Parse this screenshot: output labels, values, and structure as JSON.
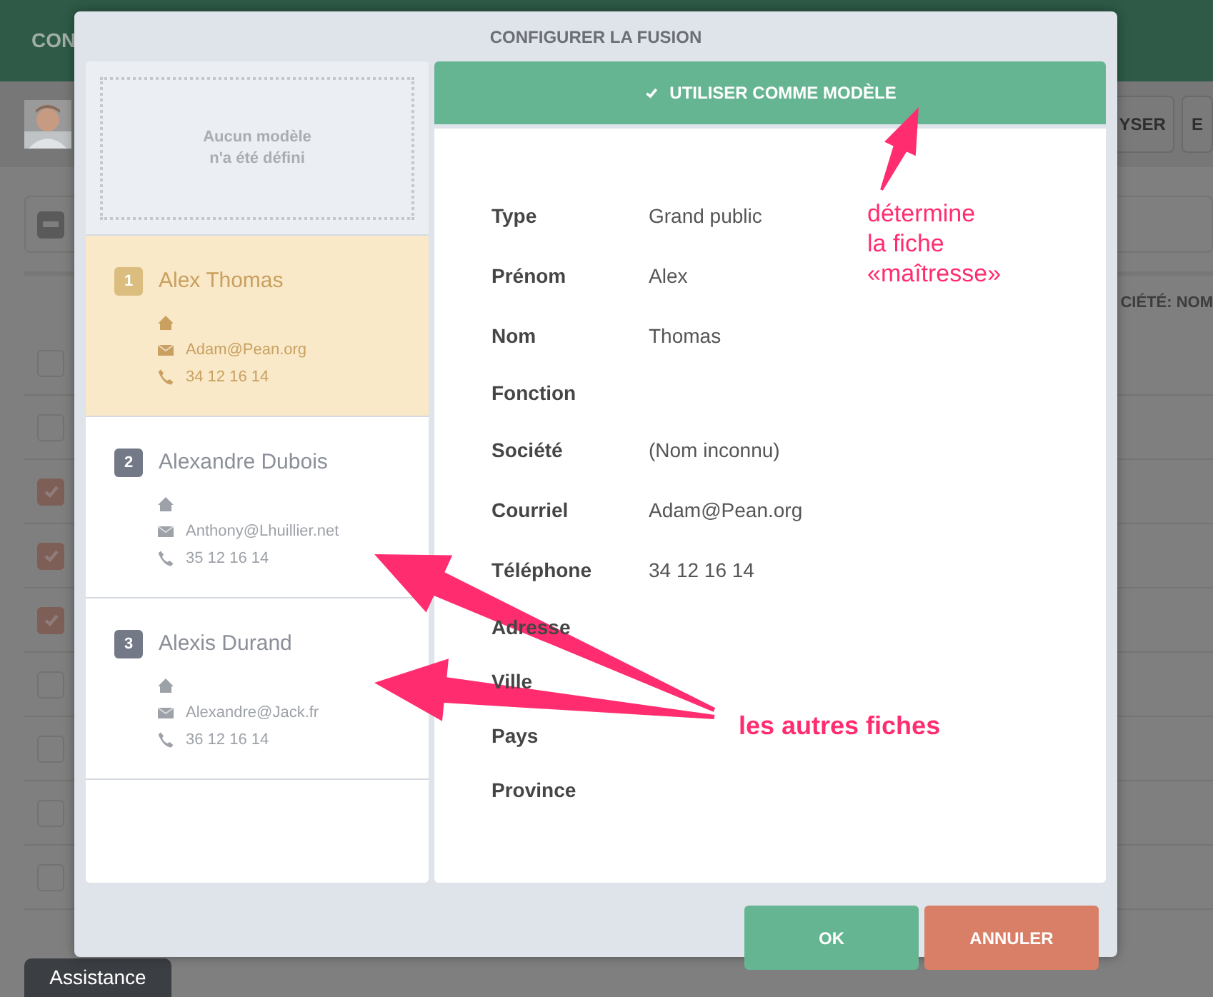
{
  "background": {
    "app_title": "CON",
    "toolbar_buttons": [
      "YSER",
      "E"
    ],
    "select_all_partial": true,
    "column_header": "CIÉTÉ: NOM",
    "rows": [
      {
        "checked": false
      },
      {
        "checked": false
      },
      {
        "checked": true
      },
      {
        "checked": true
      },
      {
        "checked": true
      },
      {
        "checked": false
      },
      {
        "checked": false
      },
      {
        "checked": false
      },
      {
        "checked": false
      }
    ],
    "help_tab": "Assistance"
  },
  "dialog": {
    "title": "CONFIGURER LA FUSION",
    "template_placeholder": [
      "Aucun modèle",
      "n'a été défini"
    ],
    "records": [
      {
        "number": "1",
        "name": "Alex Thomas",
        "email": "Adam@Pean.org",
        "phone": "34 12 16 14",
        "selected": true
      },
      {
        "number": "2",
        "name": "Alexandre Dubois",
        "email": "Anthony@Lhuillier.net",
        "phone": "35 12 16 14",
        "selected": false
      },
      {
        "number": "3",
        "name": "Alexis Durand",
        "email": "Alexandre@Jack.fr",
        "phone": "36 12 16 14",
        "selected": false
      }
    ],
    "use_as_template": "UTILISER COMME MODÈLE",
    "fields": [
      {
        "label": "Type",
        "value": "Grand public"
      },
      {
        "label": "Prénom",
        "value": "Alex"
      },
      {
        "label": "Nom",
        "value": "Thomas"
      },
      {
        "label": "Fonction"
      },
      {
        "label": "Société",
        "value": "(Nom inconnu)"
      },
      {
        "label": "Courriel",
        "value": "Adam@Pean.org"
      },
      {
        "label": "Téléphone",
        "value": "34 12 16 14"
      },
      {
        "label": "Adresse"
      },
      {
        "label": "Ville"
      },
      {
        "label": "Pays"
      },
      {
        "label": "Province"
      }
    ],
    "buttons": [
      {
        "label": "OK",
        "kind": "confirm"
      },
      {
        "label": "ANNULER",
        "kind": "cancel"
      }
    ]
  },
  "annotations": [
    {
      "lines": [
        "détermine",
        "la fiche",
        "«maîtresse»"
      ],
      "kind": "top"
    },
    {
      "lines": [
        "les autres fiches"
      ],
      "kind": "bottom"
    }
  ]
}
